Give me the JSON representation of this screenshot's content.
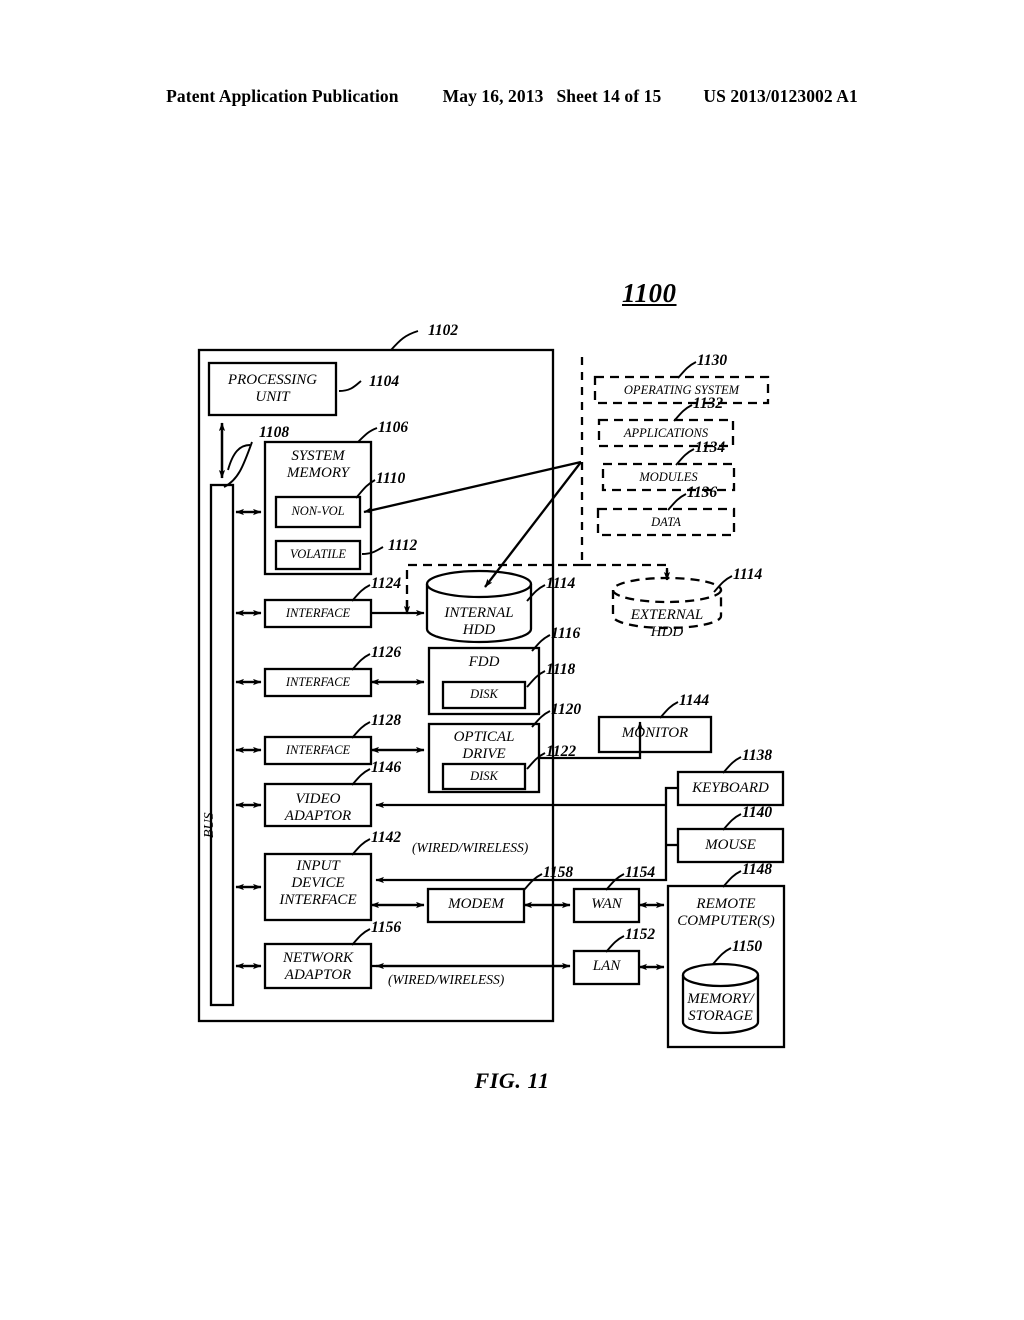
{
  "header": {
    "publication": "Patent Application Publication",
    "date": "May 16, 2013",
    "sheet": "Sheet 14 of 15",
    "docnum": "US 2013/0123002 A1"
  },
  "figure": {
    "title_number": "1100",
    "caption": "FIG. 11"
  },
  "bus_label": "BUS",
  "wired_wireless_top": "(WIRED/WIRELESS)",
  "wired_wireless_bottom": "(WIRED/WIRELESS)",
  "blocks": {
    "computer": {
      "label": "",
      "ref": "1102"
    },
    "processing_unit": {
      "label": "PROCESSING\nUNIT",
      "ref": "1104"
    },
    "bus": {
      "label": "BUS",
      "ref": "1108"
    },
    "system_memory": {
      "label": "SYSTEM\nMEMORY",
      "ref": "1106"
    },
    "non_vol": {
      "label": "NON-VOL",
      "ref": "1110"
    },
    "volatile": {
      "label": "VOLATILE",
      "ref": "1112"
    },
    "interface_hdd": {
      "label": "INTERFACE",
      "ref": "1124"
    },
    "interface_fdd": {
      "label": "INTERFACE",
      "ref": "1126"
    },
    "interface_optical": {
      "label": "INTERFACE",
      "ref": "1128"
    },
    "video_adaptor": {
      "label": "VIDEO\nADAPTOR",
      "ref": "1146"
    },
    "input_device_interface": {
      "label": "INPUT\nDEVICE\nINTERFACE",
      "ref": "1142"
    },
    "network_adaptor": {
      "label": "NETWORK\nADAPTOR",
      "ref": "1156"
    },
    "internal_hdd": {
      "label": "INTERNAL HDD",
      "ref": "1114"
    },
    "external_hdd": {
      "label": "EXTERNAL HDD",
      "ref": "1114"
    },
    "fdd": {
      "label": "FDD",
      "ref": "1116"
    },
    "fdd_disk": {
      "label": "DISK",
      "ref": "1118"
    },
    "optical_drive": {
      "label": "OPTICAL\nDRIVE",
      "ref": "1120"
    },
    "optical_disk": {
      "label": "DISK",
      "ref": "1122"
    },
    "operating_system": {
      "label": "OPERATING SYSTEM",
      "ref": "1130"
    },
    "applications": {
      "label": "APPLICATIONS",
      "ref": "1132"
    },
    "modules": {
      "label": "MODULES",
      "ref": "1134"
    },
    "data": {
      "label": "DATA",
      "ref": "1136"
    },
    "monitor": {
      "label": "MONITOR",
      "ref": "1144"
    },
    "keyboard": {
      "label": "KEYBOARD",
      "ref": "1138"
    },
    "mouse": {
      "label": "MOUSE",
      "ref": "1140"
    },
    "modem": {
      "label": "MODEM",
      "ref": "1158"
    },
    "wan": {
      "label": "WAN",
      "ref": "1154"
    },
    "lan": {
      "label": "LAN",
      "ref": "1152"
    },
    "remote_computers": {
      "label": "REMOTE\nCOMPUTER(S)",
      "ref": "1148"
    },
    "memory_storage": {
      "label": "MEMORY/\nSTORAGE",
      "ref": "1150"
    }
  }
}
